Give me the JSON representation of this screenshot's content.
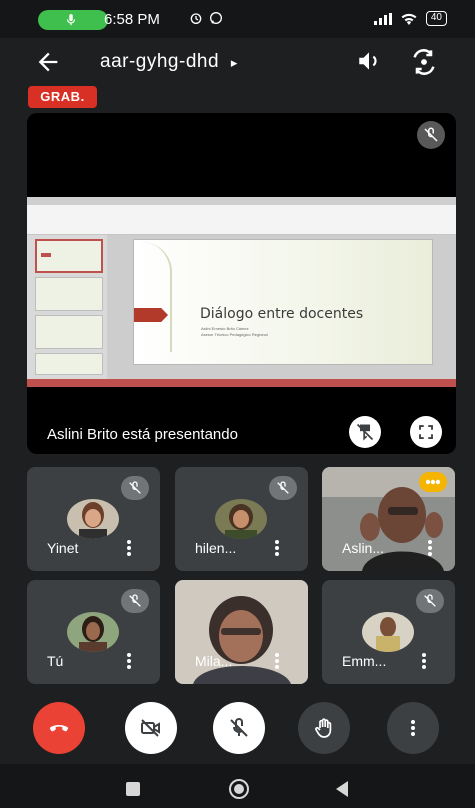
{
  "status_bar": {
    "time": "6:58 PM",
    "battery": "40"
  },
  "header": {
    "meeting_code": "aar-gyhg-dhd",
    "code_chevron": "▸",
    "recording_badge": "GRAB."
  },
  "presentation": {
    "presenting_label": "Aslini Brito está presentando",
    "slide_title": "Diálogo entre docentes",
    "slide_subtitle_1": "Aslini Ernesto Brito Cámez",
    "slide_subtitle_2": "Asesor Técnico Pedagógico Regional"
  },
  "participants": [
    {
      "name": "Yinet",
      "mic_muted": true
    },
    {
      "name": "hilen...",
      "mic_muted": true
    },
    {
      "name": "Aslin...",
      "mic_muted": false,
      "speaking": true
    },
    {
      "name": "Tú",
      "mic_muted": true
    },
    {
      "name": "Mila...",
      "mic_muted": false
    },
    {
      "name": "Emm...",
      "mic_muted": true
    }
  ],
  "controls": [
    {
      "name": "end-call",
      "icon": "phone-hangup-icon"
    },
    {
      "name": "camera",
      "icon": "camera-off-icon"
    },
    {
      "name": "microphone",
      "icon": "mic-off-icon"
    },
    {
      "name": "raise-hand",
      "icon": "hand-icon"
    },
    {
      "name": "more-options",
      "icon": "more-vert-icon"
    }
  ],
  "colors": {
    "background": "#1e1f21",
    "tile": "#3c4043",
    "hangup": "#ea4335",
    "recording": "#d93025",
    "call_pill": "#3fbf4d",
    "speaking": "#f4b400"
  }
}
